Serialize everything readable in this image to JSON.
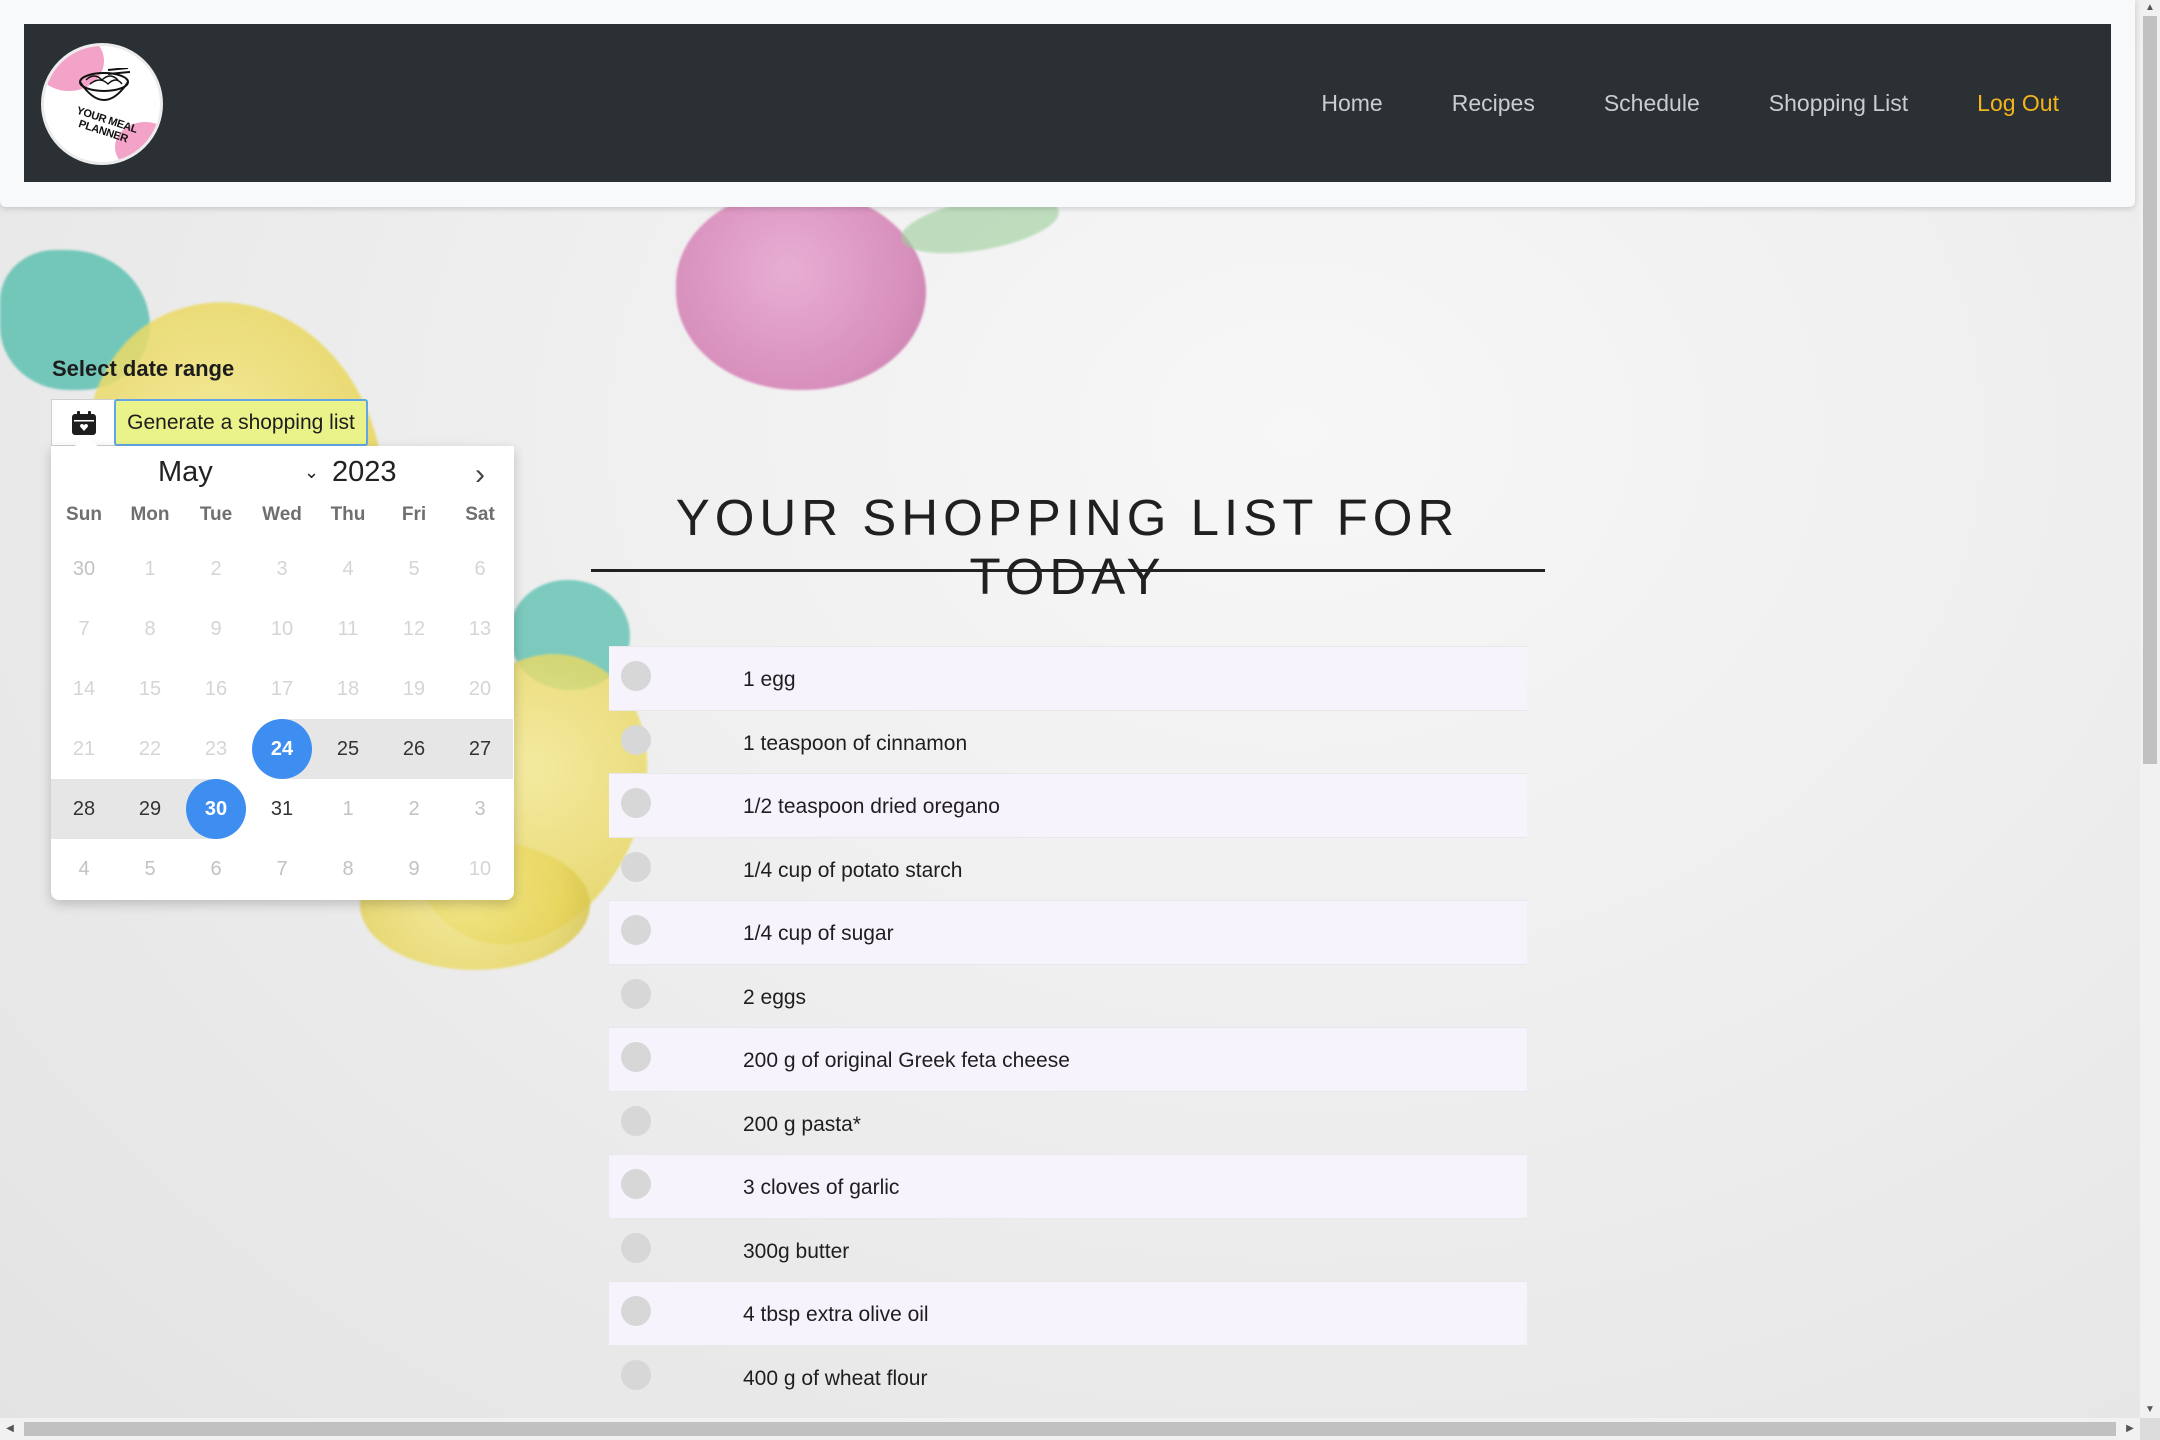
{
  "brand": {
    "logo_text": "YOUR MEAL PLANNER"
  },
  "nav": {
    "items": [
      {
        "label": "Home"
      },
      {
        "label": "Recipes"
      },
      {
        "label": "Schedule"
      },
      {
        "label": "Shopping List"
      }
    ],
    "logout_label": "Log Out"
  },
  "date_range": {
    "title": "Select date range",
    "generate_label": "Generate a shopping list"
  },
  "datepicker": {
    "month": "May",
    "year": "2023",
    "weekdays": [
      "Sun",
      "Mon",
      "Tue",
      "Wed",
      "Thu",
      "Fri",
      "Sat"
    ],
    "weeks": [
      [
        "30",
        "1",
        "2",
        "3",
        "4",
        "5",
        "6"
      ],
      [
        "7",
        "8",
        "9",
        "10",
        "11",
        "12",
        "13"
      ],
      [
        "14",
        "15",
        "16",
        "17",
        "18",
        "19",
        "20"
      ],
      [
        "21",
        "22",
        "23",
        "24",
        "25",
        "26",
        "27"
      ],
      [
        "28",
        "29",
        "30",
        "31",
        "1",
        "2",
        "3"
      ],
      [
        "4",
        "5",
        "6",
        "7",
        "8",
        "9",
        "10"
      ]
    ],
    "range_start": "24",
    "range_end": "30"
  },
  "shopping_list": {
    "title": "YOUR SHOPPING LIST FOR TODAY",
    "items": [
      "1 egg",
      "1 teaspoon of cinnamon",
      "1/2 teaspoon dried oregano",
      "1/4 cup of potato starch",
      "1/4 cup of sugar",
      "2 eggs",
      "200 g of original Greek feta cheese",
      "200 g pasta*",
      "3 cloves of garlic",
      "300g butter",
      "4 tbsp extra olive oil",
      "400 g of wheat flour"
    ]
  },
  "colors": {
    "navbar_bg": "#2b3034",
    "nav_link": "#c9ccd0",
    "logout": "#f3b51a",
    "accent_blue": "#3d8ef0",
    "generate_button": "#e9f38a"
  }
}
